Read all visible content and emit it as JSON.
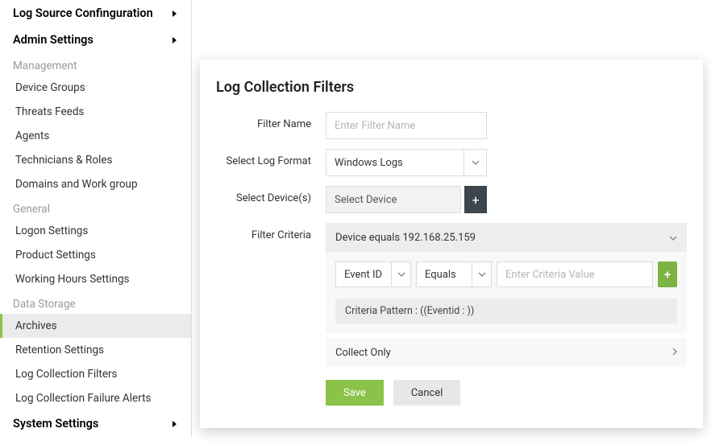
{
  "sidebar": {
    "top1": "Log Source Confinguration",
    "top2": "Admin Settings",
    "groups": {
      "management": {
        "label": "Management",
        "items": [
          "Device Groups",
          "Threats Feeds",
          "Agents",
          "Technicians & Roles",
          "Domains and Work group"
        ]
      },
      "general": {
        "label": "General",
        "items": [
          "Logon Settings",
          "Product Settings",
          "Working Hours Settings"
        ]
      },
      "data_storage": {
        "label": "Data Storage",
        "items": [
          "Archives",
          "Retention Settings",
          "Log Collection Filters",
          "Log Collection Failure Alerts"
        ]
      }
    },
    "bottom": "System Settings",
    "active_item": "Archives"
  },
  "panel": {
    "title": "Log Collection Filters",
    "labels": {
      "filter_name": "Filter Name",
      "log_format": "Select Log Format",
      "devices": "Select Device(s)",
      "criteria": "Filter Criteria"
    },
    "filter_name_placeholder": "Enter Filter Name",
    "log_format_value": "Windows Logs",
    "device_value": "Select Device",
    "criteria_header": "Device equals 192.168.25.159",
    "criteria_field": "Event ID",
    "criteria_op": "Equals",
    "criteria_value_placeholder": "Enter Criteria Value",
    "criteria_pattern": "Criteria Pattern : ((Eventid : ))",
    "collect_only": "Collect Only",
    "save": "Save",
    "cancel": "Cancel"
  }
}
